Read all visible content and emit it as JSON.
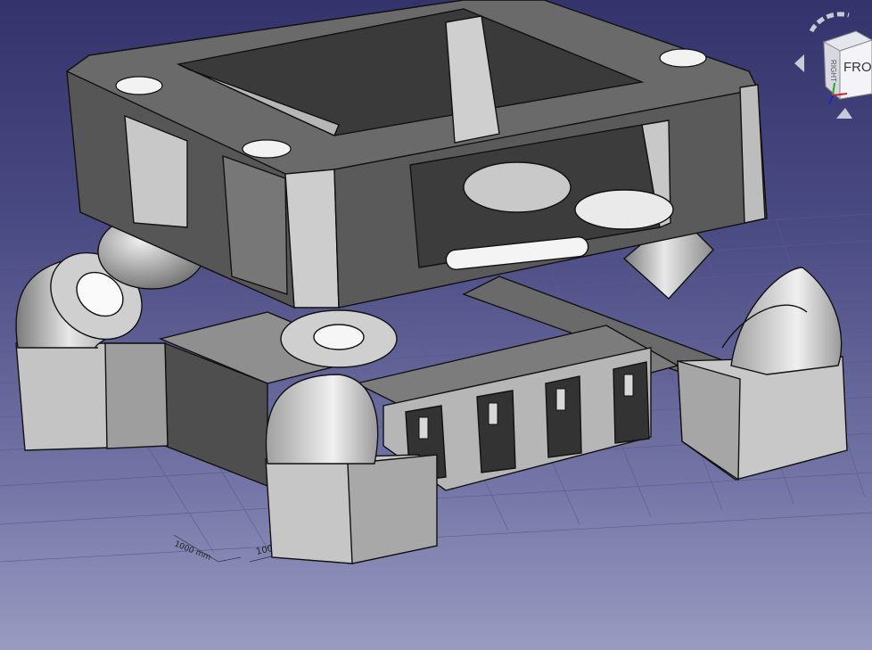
{
  "viewport": {
    "ruler_label_front": "1000 mm",
    "ruler_label_side": "1000 mm"
  },
  "nav_cube": {
    "face_front": "FRO",
    "face_side": "RIGHT"
  },
  "colors": {
    "background_top": "#34336b",
    "background_bottom": "#9a9bc1",
    "part_light": "#c6c6c6",
    "part_mid": "#9a9a9a",
    "part_dark": "#585858",
    "edge": "#111111",
    "grid": "#5a5a8c"
  },
  "icons": [
    "rotate-view-icon",
    "arrow-left-icon",
    "arrow-down-icon",
    "axis-triad-icon"
  ]
}
